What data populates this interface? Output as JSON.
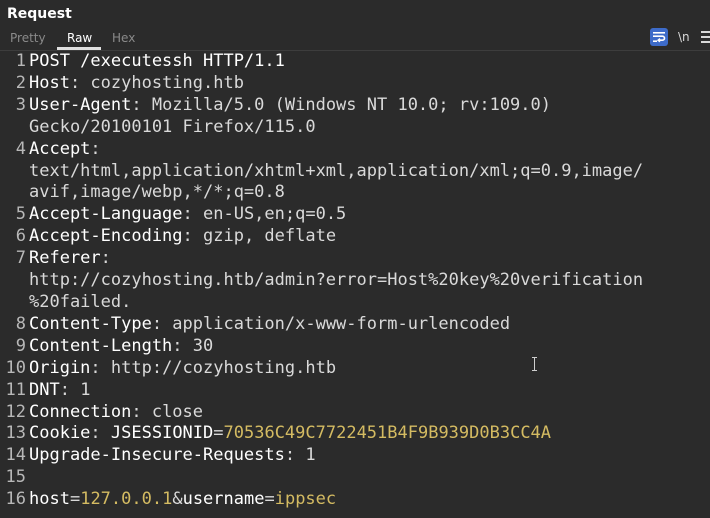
{
  "panel": {
    "title": "Request"
  },
  "tabs": [
    {
      "label": "Pretty",
      "active": false
    },
    {
      "label": "Raw",
      "active": true
    },
    {
      "label": "Hex",
      "active": false
    }
  ],
  "toolbar": {
    "wrap_icon": "wrap-lines-icon",
    "newline_label": "\\n",
    "menu_icon": "menu-icon"
  },
  "colors": {
    "background": "#2b2b2b",
    "cookie_value": "#d4bb62",
    "toggle_active": "#3d6bc9"
  },
  "lines": [
    {
      "n": "1",
      "parts": [
        {
          "t": "POST /executessh HTTP/1.1",
          "c": "k"
        }
      ]
    },
    {
      "n": "2",
      "parts": [
        {
          "t": "Host",
          "c": "k"
        },
        {
          "t": ": cozyhosting.htb",
          "c": "v"
        }
      ]
    },
    {
      "n": "3",
      "parts": [
        {
          "t": "User-Agent",
          "c": "k"
        },
        {
          "t": ": Mozilla/5.0 (Windows NT 10.0; rv:109.0)",
          "c": "v"
        }
      ]
    },
    {
      "n": "",
      "parts": [
        {
          "t": "Gecko/20100101 Firefox/115.0",
          "c": "v"
        }
      ]
    },
    {
      "n": "4",
      "parts": [
        {
          "t": "Accept",
          "c": "k"
        },
        {
          "t": ":",
          "c": "v"
        }
      ]
    },
    {
      "n": "",
      "parts": [
        {
          "t": "text/html,application/xhtml+xml,application/xml;q=0.9,image/",
          "c": "v"
        }
      ]
    },
    {
      "n": "",
      "parts": [
        {
          "t": "avif,image/webp,*/*;q=0.8",
          "c": "v"
        }
      ]
    },
    {
      "n": "5",
      "parts": [
        {
          "t": "Accept-Language",
          "c": "k"
        },
        {
          "t": ": en-US,en;q=0.5",
          "c": "v"
        }
      ]
    },
    {
      "n": "6",
      "parts": [
        {
          "t": "Accept-Encoding",
          "c": "k"
        },
        {
          "t": ": gzip, deflate",
          "c": "v"
        }
      ]
    },
    {
      "n": "7",
      "parts": [
        {
          "t": "Referer",
          "c": "k"
        },
        {
          "t": ":",
          "c": "v"
        }
      ]
    },
    {
      "n": "",
      "parts": [
        {
          "t": "http://cozyhosting.htb/admin?error=Host%20key%20verification",
          "c": "v"
        }
      ]
    },
    {
      "n": "",
      "parts": [
        {
          "t": "%20failed.",
          "c": "v"
        }
      ]
    },
    {
      "n": "8",
      "parts": [
        {
          "t": "Content-Type",
          "c": "k"
        },
        {
          "t": ": application/x-www-form-urlencoded",
          "c": "v"
        }
      ]
    },
    {
      "n": "9",
      "parts": [
        {
          "t": "Content-Length",
          "c": "k"
        },
        {
          "t": ": 30",
          "c": "v"
        }
      ]
    },
    {
      "n": "10",
      "parts": [
        {
          "t": "Origin",
          "c": "k"
        },
        {
          "t": ": http://cozyhosting.htb",
          "c": "v"
        }
      ]
    },
    {
      "n": "11",
      "parts": [
        {
          "t": "DNT",
          "c": "k"
        },
        {
          "t": ": 1",
          "c": "v"
        }
      ]
    },
    {
      "n": "12",
      "parts": [
        {
          "t": "Connection",
          "c": "k"
        },
        {
          "t": ": close",
          "c": "v"
        }
      ]
    },
    {
      "n": "13",
      "parts": [
        {
          "t": "Cookie",
          "c": "k"
        },
        {
          "t": ": ",
          "c": "v"
        },
        {
          "t": "JSESSIONID",
          "c": "k"
        },
        {
          "t": "=",
          "c": "v"
        },
        {
          "t": "70536C49C7722451B4F9B939D0B3CC4A",
          "c": "c"
        }
      ]
    },
    {
      "n": "14",
      "parts": [
        {
          "t": "Upgrade-Insecure-Requests",
          "c": "k"
        },
        {
          "t": ": 1",
          "c": "v"
        }
      ]
    },
    {
      "n": "15",
      "parts": [
        {
          "t": "",
          "c": "v"
        }
      ]
    },
    {
      "n": "16",
      "parts": [
        {
          "t": "host",
          "c": "k"
        },
        {
          "t": "=",
          "c": "v"
        },
        {
          "t": "127.0.0.1",
          "c": "c"
        },
        {
          "t": "&",
          "c": "v"
        },
        {
          "t": "username",
          "c": "k"
        },
        {
          "t": "=",
          "c": "v"
        },
        {
          "t": "ippsec",
          "c": "c"
        }
      ]
    }
  ]
}
